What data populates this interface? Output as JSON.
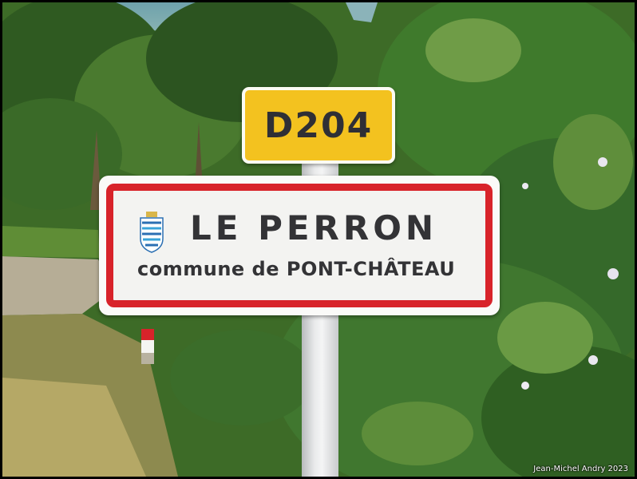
{
  "photo": {
    "route_plate": {
      "text": "D204",
      "color": "#f3c21f"
    },
    "town_sign": {
      "town_name": "LE PERRON",
      "commune_line": "commune de PONT-CHÂTEAU",
      "border_color": "#d8232a",
      "crest_icon": "coat-of-arms-icon"
    },
    "roadside_marker": {
      "colors": [
        "#d8232a",
        "#ffffff"
      ]
    },
    "credit": "Jean-Michel Andry 2023"
  }
}
